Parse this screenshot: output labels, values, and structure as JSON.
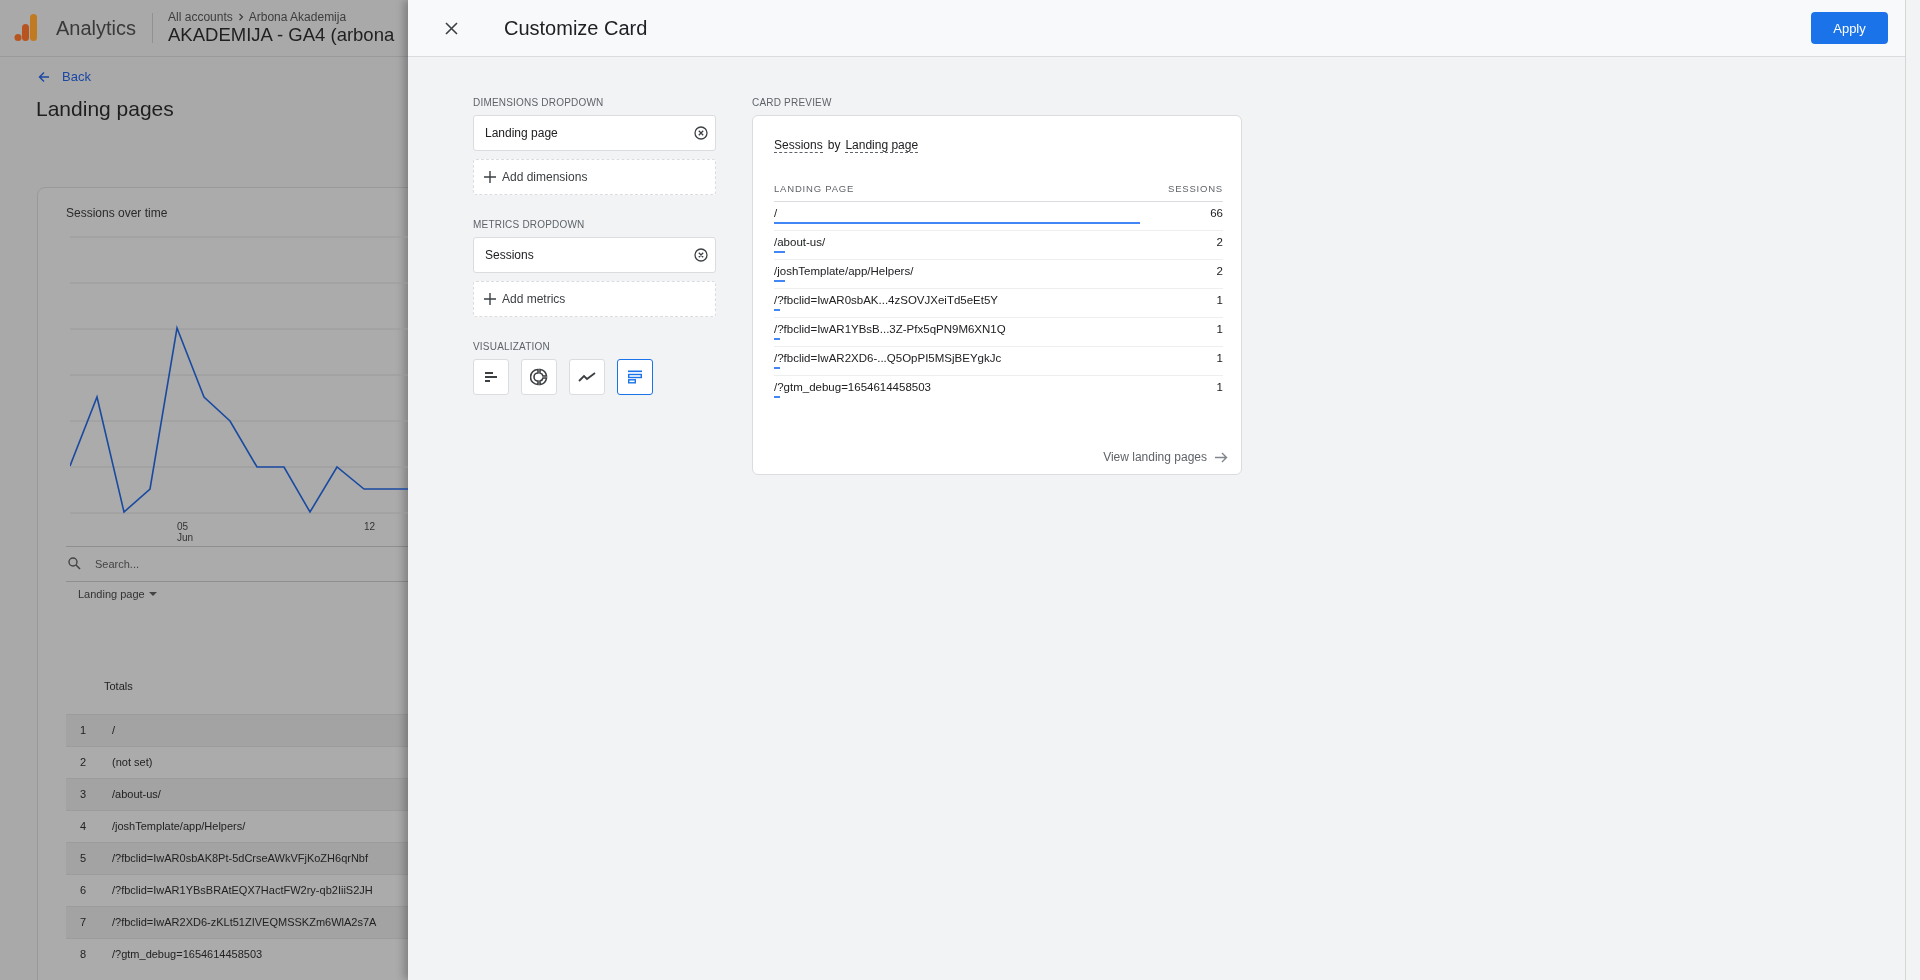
{
  "app_bar": {
    "product": "Analytics",
    "breadcrumb": [
      "All accounts",
      "Arbona Akademija"
    ],
    "property": "AKADEMIJA - GA4 (arbona"
  },
  "page": {
    "back": "Back",
    "title": "Landing pages",
    "chart_card": {
      "title": "Sessions over time",
      "x_ticks": [
        {
          "day": "05",
          "month": "Jun"
        },
        {
          "day": "12"
        }
      ]
    },
    "search": {
      "placeholder": "Search..."
    },
    "dimension_menu": "Landing page",
    "table": {
      "totals": "Totals",
      "rows": [
        {
          "index": "1",
          "page": "/"
        },
        {
          "index": "2",
          "page": "(not set)"
        },
        {
          "index": "3",
          "page": "/about-us/"
        },
        {
          "index": "4",
          "page": "/joshTemplate/app/Helpers/"
        },
        {
          "index": "5",
          "page": "/?fbclid=IwAR0sbAK8Pt-5dCrseAWkVFjKoZH6qrNbf"
        },
        {
          "index": "6",
          "page": "/?fbclid=IwAR1YBsBRAtEQX7HactFW2ry-qb2IiiS2JH"
        },
        {
          "index": "7",
          "page": "/?fbclid=IwAR2XD6-zKLt51ZIVEQMSSKZm6WlA2s7A"
        },
        {
          "index": "8",
          "page": "/?gtm_debug=1654614458503"
        }
      ]
    }
  },
  "drawer": {
    "title": "Customize Card",
    "apply": "Apply",
    "dimensions": {
      "label": "DIMENSIONS DROPDOWN",
      "chips": [
        "Landing page"
      ],
      "add": "Add dimensions"
    },
    "metrics": {
      "label": "METRICS DROPDOWN",
      "chips": [
        "Sessions"
      ],
      "add": "Add metrics"
    },
    "visualization": {
      "label": "VISUALIZATION",
      "options": [
        {
          "kind": "bar",
          "selected": false
        },
        {
          "kind": "donut",
          "selected": false
        },
        {
          "kind": "line",
          "selected": false
        },
        {
          "kind": "table",
          "selected": true
        }
      ]
    },
    "preview": {
      "label": "CARD PREVIEW",
      "title": {
        "metric": "Sessions",
        "connector": "by",
        "dimension": "Landing page"
      },
      "columns": [
        "LANDING PAGE",
        "SESSIONS"
      ],
      "rows": [
        {
          "page": "/",
          "sessions": "66",
          "level": 0.815
        },
        {
          "page": "/about-us/",
          "sessions": "2",
          "level": 0.025
        },
        {
          "page": "/joshTemplate/app/Helpers/",
          "sessions": "2",
          "level": 0.025
        },
        {
          "page": "/?fbclid=IwAR0sbAK...4zSOVJXeiTd5eEt5Y",
          "sessions": "1",
          "level": 0.013
        },
        {
          "page": "/?fbclid=IwAR1YBsB...3Z-Pfx5qPN9M6XN1Q",
          "sessions": "1",
          "level": 0.013
        },
        {
          "page": "/?fbclid=IwAR2XD6-...Q5OpPI5MSjBEYgkJc",
          "sessions": "1",
          "level": 0.013
        },
        {
          "page": "/?gtm_debug=1654614458503",
          "sessions": "1",
          "level": 0.013
        }
      ],
      "link": "View landing pages"
    }
  }
}
